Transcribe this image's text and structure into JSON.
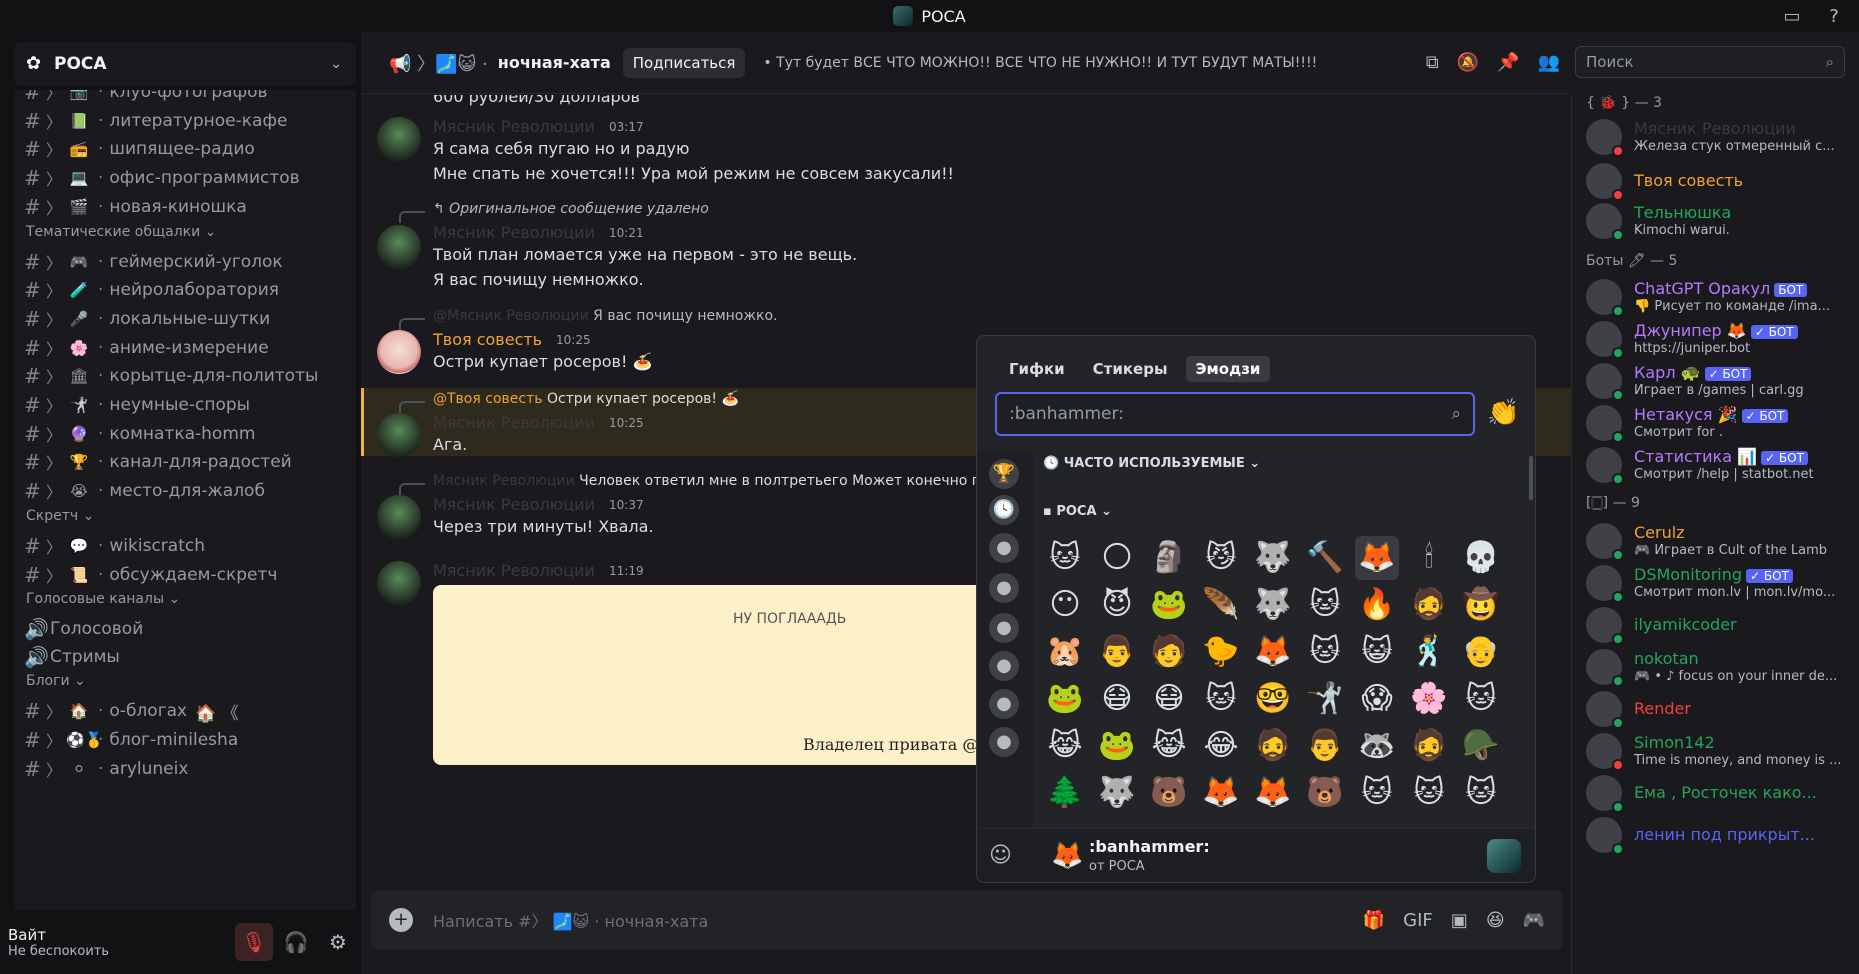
{
  "window": {
    "title": "РОСА"
  },
  "server": {
    "name": "РОСА"
  },
  "channels": [
    {
      "label": "клуб-фотографов",
      "emoji": "📷",
      "cut": true
    },
    {
      "label": "литературное-кафе",
      "emoji": "📗"
    },
    {
      "label": "шипящее-радио",
      "emoji": "📻"
    },
    {
      "label": "офис-программистов",
      "emoji": "💻"
    },
    {
      "label": "новая-киношка",
      "emoji": "🎬"
    }
  ],
  "categories": {
    "thematic": "Тематические общалки ⌄",
    "scratch": "Скретч ⌄",
    "voice": "Голосовые каналы ⌄",
    "blogs": "Блоги ⌄"
  },
  "thematic_channels": [
    {
      "label": "геймерский-уголок",
      "emoji": "🎮"
    },
    {
      "label": "нейролаборатория",
      "emoji": "🧪"
    },
    {
      "label": "локальные-шутки",
      "emoji": "🎤"
    },
    {
      "label": "аниме-измерение",
      "emoji": "🌸"
    },
    {
      "label": "корытце-для-политоты",
      "emoji": "🏛"
    },
    {
      "label": "неумные-споры",
      "emoji": "🤺"
    },
    {
      "label": "комнатка-homm",
      "emoji": "🔮"
    },
    {
      "label": "канал-для-радостей",
      "emoji": "🏆"
    },
    {
      "label": "место-для-жалоб",
      "emoji": "😭"
    }
  ],
  "scratch_channels": [
    {
      "label": "wikiscratch",
      "emoji": "💬"
    },
    {
      "label": "обсуждаем-скретч",
      "emoji": "📜"
    }
  ],
  "voice_channels": [
    {
      "label": "Голосовой"
    },
    {
      "label": "Стримы"
    }
  ],
  "blog_channels": [
    {
      "label": "о-блогах",
      "emoji": "🏠",
      "suffix": "🏠 《"
    },
    {
      "label": "блог-minilesha",
      "emoji": "⚽🥇"
    },
    {
      "label": "aryluneix",
      "emoji": "⚪"
    }
  ],
  "user": {
    "name": "Вайт",
    "status": "Не беспокоить"
  },
  "header": {
    "channel": "ночная-хата",
    "subscribe": "Подписаться",
    "topic": "Тут будет ВСЕ ЧТО МОЖНО!! ВСЕ ЧТО НЕ НУЖНО!! И ТУТ БУДУТ МАТЫ!!!!"
  },
  "search": {
    "placeholder": "Поиск"
  },
  "messages": {
    "m0": {
      "text": "600 рублей/30 долларов"
    },
    "m1": {
      "author": "Мясник Революции",
      "time": "03:17",
      "line1": "Я сама себя пугаю но и радую",
      "line2": "Мне спать не хочется!!! Ура мой режим не совсем закусали!!"
    },
    "m2": {
      "reply": "↰ Оригинальное сообщение удалено",
      "author": "Мясник Революции",
      "time": "10:21",
      "line1": "Твой план ломается уже на первом - это не вещь.",
      "line2": "Я вас почищу немножко."
    },
    "m3": {
      "reply_author": "@Мясник Революции",
      "reply_text": "Я вас почищу немножко.",
      "author": "Твоя совесть",
      "time": "10:25",
      "line1": "Остри купает росеров! 🍝"
    },
    "m4": {
      "reply_author": "@Твоя совесть",
      "reply_text": "Остри купает росеров! 🍝",
      "author": "Мясник Революции",
      "time": "10:25",
      "line1": "Ага."
    },
    "m5": {
      "reply_author": "Мясник Революции",
      "reply_text": "Человек ответил мне в полтретьего  Может конечно пр",
      "author": "Мясник Революции",
      "time": "10:37",
      "line1": "Через три минуты! Хвала."
    },
    "m6": {
      "author": "Мясник Революции",
      "time": "11:19",
      "img_text": "НУ ПОГЛАААДЬ",
      "img_caption": "Владелец привата @"
    }
  },
  "composer": {
    "placeholder": "Написать #〉 🗾😺 · ночная-хата"
  },
  "members": {
    "groups": [
      {
        "title": "{ 🐞 } — 3"
      },
      {
        "title": "Боты 🖊 — 5"
      },
      {
        "title": "[🀆] — 9"
      }
    ],
    "list": [
      {
        "name": "Мясник Революции",
        "sub": "Железа стук отмеренный с...",
        "color": "#3a3a3e",
        "status": "#f23f43"
      },
      {
        "name": "Твоя совесть",
        "sub": "",
        "color": "#f0a232",
        "status": "#f23f43"
      },
      {
        "name": "Тельнюшка",
        "sub": "Kimochi warui.",
        "color": "#23a55a",
        "status": "#23a55a"
      },
      {
        "name": "ChatGPT Оракул",
        "sub": "👎 Рисует по команде /ima...",
        "color": "#b57aff",
        "status": "#23a55a",
        "bot": "БОТ"
      },
      {
        "name": "Джунипер 🦊",
        "sub": "https://juniper.bot",
        "color": "#b57aff",
        "status": "#23a55a",
        "bot": "✓ БОТ"
      },
      {
        "name": "Карл 🐢",
        "sub": "Играет в /games | carl.gg",
        "color": "#b57aff",
        "status": "#23a55a",
        "bot": "✓ БОТ"
      },
      {
        "name": "Нетакуся 🎉",
        "sub": "Смотрит for .",
        "color": "#b57aff",
        "status": "#23a55a",
        "bot": "✓ БОТ"
      },
      {
        "name": "Статистика 📊",
        "sub": "Смотрит /help | statbot.net",
        "color": "#b57aff",
        "status": "#23a55a",
        "bot": "✓ БОТ"
      },
      {
        "name": "Cerulz",
        "sub": "🎮 Играет в Cult of the Lamb",
        "color": "#f0a232",
        "status": "#23a55a"
      },
      {
        "name": "DSMonitoring",
        "sub": "Смотрит mon.lv | mon.lv/mo...",
        "color": "#23a55a",
        "status": "#23a55a",
        "bot": "✓ БОТ"
      },
      {
        "name": "ilyamikcoder",
        "sub": "",
        "color": "#23a55a",
        "status": "#23a55a"
      },
      {
        "name": "nokotan",
        "sub": "🎮 • ♪ focus on your inner de...",
        "color": "#23a55a",
        "status": "#23a55a"
      },
      {
        "name": "Render",
        "sub": "",
        "color": "#f23f43",
        "status": "#23a55a"
      },
      {
        "name": "Simon142",
        "sub": "Time is money, and money is ...",
        "color": "#23a55a",
        "status": "#f23f43"
      },
      {
        "name": "Ема , Росточек како...",
        "sub": "",
        "color": "#23a55a",
        "status": "#23a55a"
      },
      {
        "name": "ленин под прикрыт...",
        "sub": "",
        "color": "#5865f2",
        "status": "#23a55a"
      }
    ]
  },
  "picker": {
    "tabs": [
      "Гифки",
      "Стикеры",
      "Эмодзи"
    ],
    "input_value": ":banhammer:",
    "section_frequent": "ЧАСТО ИСПОЛЬЗУЕМЫЕ",
    "section_server": "РОСА",
    "emojis": [
      "🐱",
      "🌕",
      "🗿",
      "😼",
      "🐺",
      "🔨",
      "🦊",
      "🕯",
      "💀",
      "😶",
      "😈",
      "🐸",
      "🪶",
      "🐺",
      "🐱",
      "🔥",
      "🧔",
      "🤠",
      "🐹",
      "👨",
      "🧑",
      "🐤",
      "🦊",
      "🐱",
      "😺",
      "🕺",
      "👴",
      "🐸",
      "😷",
      "😷",
      "🐱",
      "🤓",
      "🤺",
      "😱",
      "🌸",
      "🐱",
      "😹",
      "🐸",
      "😹",
      "😂",
      "🧔",
      "👨",
      "🦝",
      "🧔",
      "🪖",
      "🌲",
      "🐺",
      "🐻",
      "🦊",
      "🦊",
      "🐻",
      "🐱",
      "🐱",
      "🐱"
    ],
    "footer_name": ":banhammer:",
    "footer_source": "от РОСА"
  }
}
